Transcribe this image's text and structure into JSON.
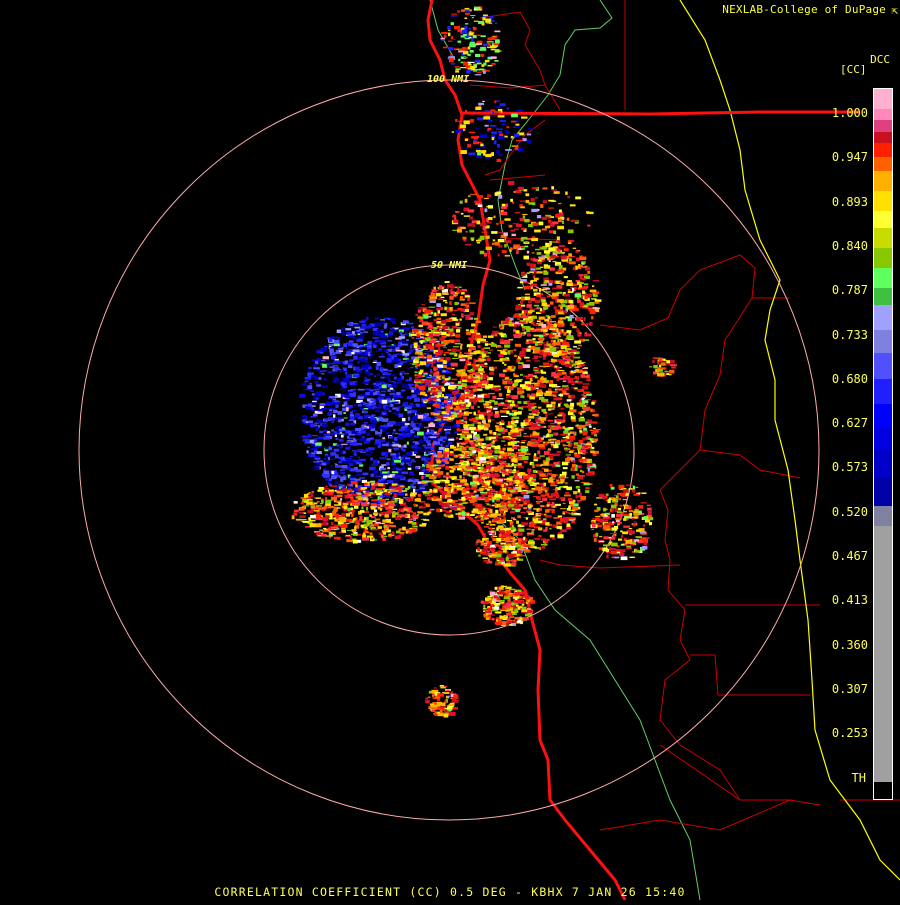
{
  "credit": "NEXLAB-College of DuPage",
  "credit_icon": "corner-arrow-icon",
  "product_code": "DCC",
  "unit_label": "[CC]",
  "footer": "CORRELATION COEFFICIENT (CC) 0.5 DEG - KBHX 7 JAN 26 15:40",
  "range_rings": [
    {
      "label": "50 NMI"
    },
    {
      "label": "100 NMI"
    }
  ],
  "legend": {
    "ticks": [
      "1.000",
      "0.947",
      "0.893",
      "0.840",
      "0.787",
      "0.733",
      "0.680",
      "0.627",
      "0.573",
      "0.520",
      "0.467",
      "0.413",
      "0.360",
      "0.307",
      "0.253",
      "TH"
    ],
    "colors": [
      "#ffb0d0",
      "#ff88b8",
      "#e04080",
      "#c81020",
      "#ff2000",
      "#ff6000",
      "#ffb000",
      "#ffe000",
      "#ffff33",
      "#c8dc00",
      "#88c800",
      "#60ff60",
      "#40c040",
      "#a0a0ff",
      "#8080e0",
      "#5050ff",
      "#2020ff",
      "#0000ff",
      "#0000e0",
      "#0000c8",
      "#0000a8",
      "#8080a0",
      "#a0a0a0",
      "#000000"
    ]
  },
  "colors": {
    "state_border": "#ffff00",
    "county_border": "#cc0000",
    "highway": "#ff1010",
    "green_boundary": "#66cc66",
    "range_ring": "#ffaaaa",
    "text": "#ffff55"
  }
}
